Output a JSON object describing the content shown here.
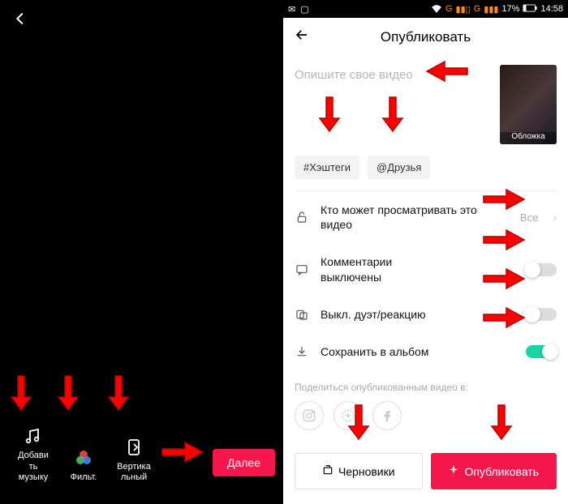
{
  "left": {
    "tools": {
      "music": "Добави\nть\nмузыку",
      "filter": "Фильт.",
      "vertical": "Вертика\nльный"
    },
    "next": "Далее"
  },
  "right": {
    "status": {
      "carrier1": "G",
      "carrier2": "G",
      "battery": "17%",
      "time": "14:58"
    },
    "header": "Опубликовать",
    "description_placeholder": "Опишите свое видео",
    "cover_label": "Обложка",
    "chip_hashtags": "#Хэштеги",
    "chip_friends": "@Друзья",
    "privacy_label": "Кто может просматривать это\nвидео",
    "privacy_value": "Все",
    "comments_label": "Комментарии\nвыключены",
    "duet_label": "Выкл. дуэт/реакцию",
    "save_label": "Сохранить в альбом",
    "share_label": "Поделиться опубликованным видео в:",
    "drafts": "Черновики",
    "publish": "Опубликовать"
  }
}
